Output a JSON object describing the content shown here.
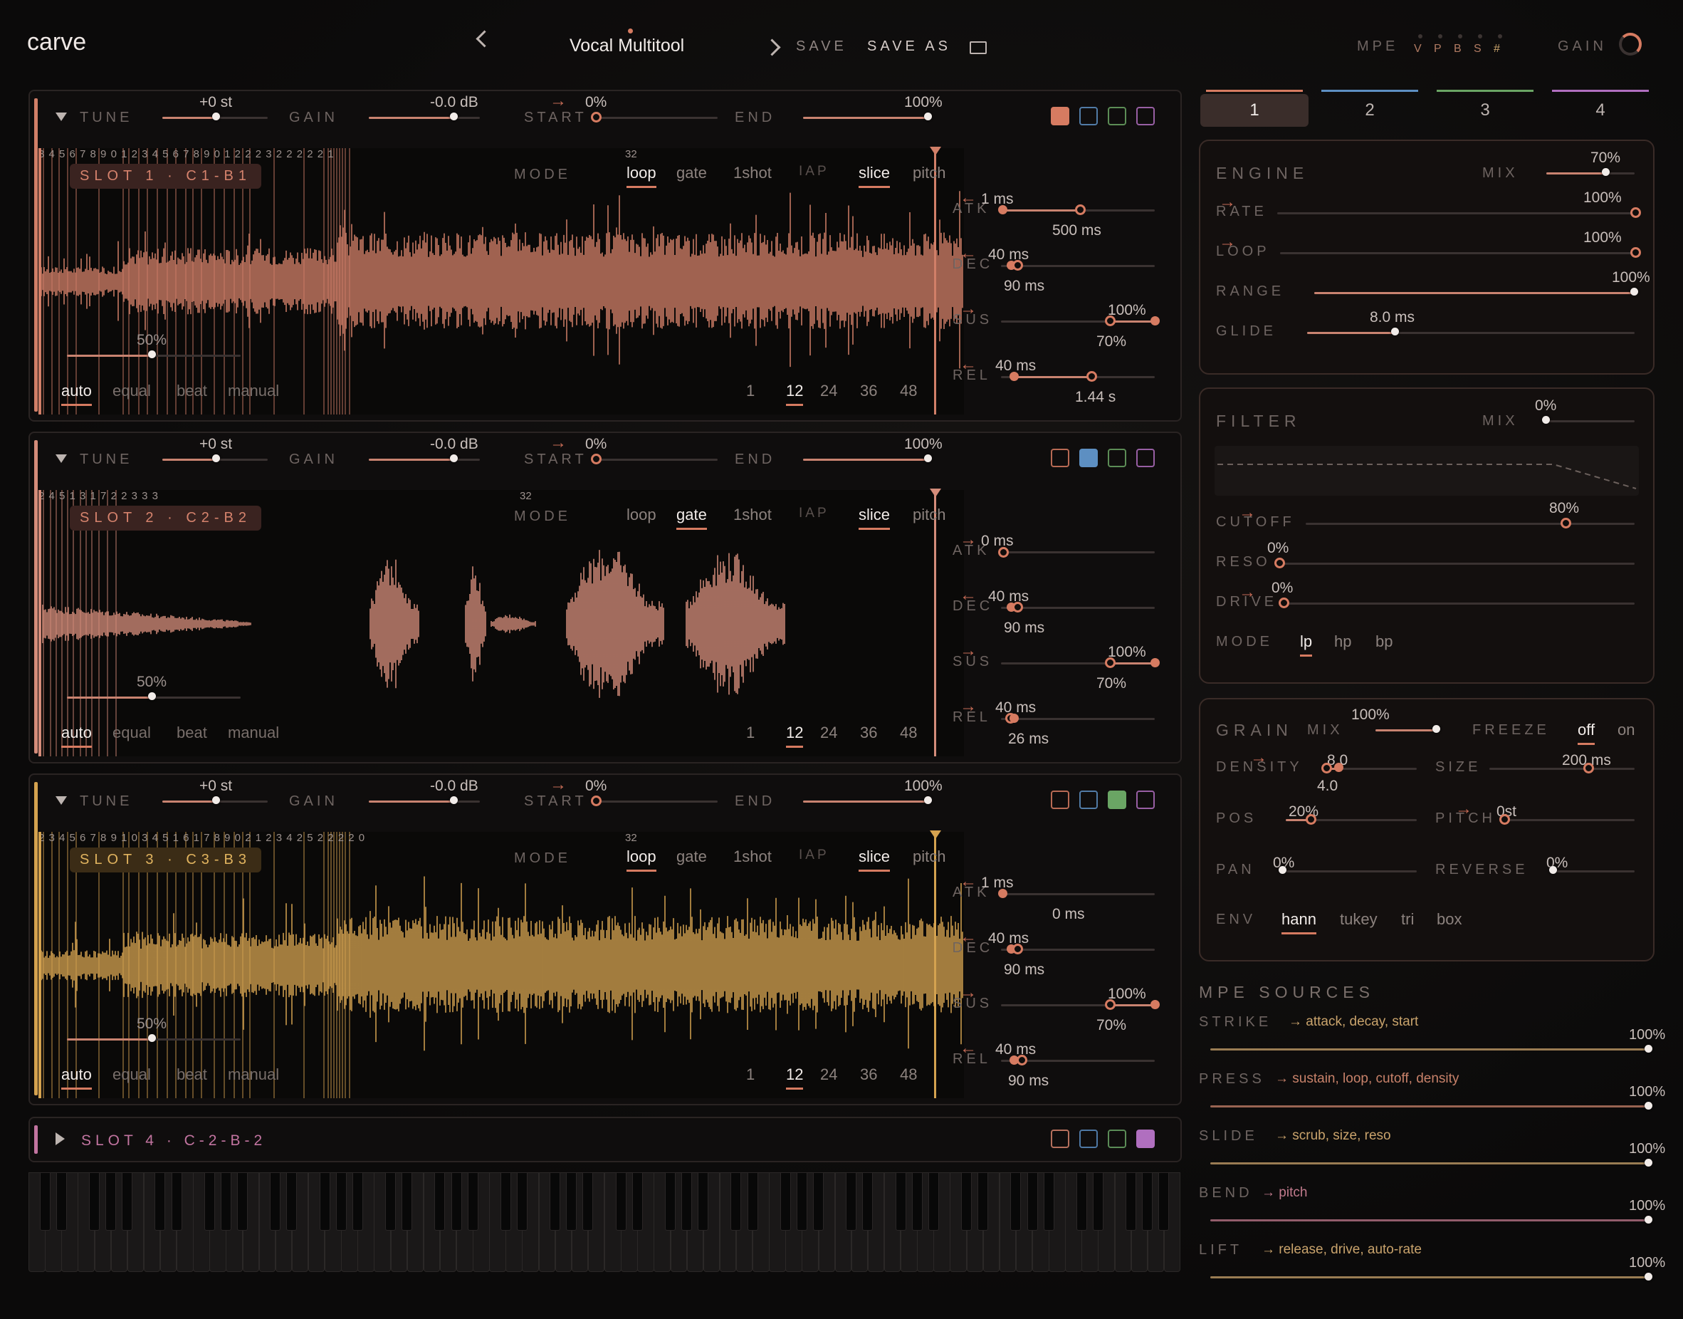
{
  "header": {
    "logo": "carve",
    "preset_name": "Vocal Multitool",
    "save": "SAVE",
    "save_as": "SAVE AS",
    "mpe": "MPE",
    "mpe_flags": [
      "V",
      "P",
      "B",
      "S",
      "#"
    ],
    "gain": "GAIN"
  },
  "labels": {
    "tune": "TUNE",
    "gain": "GAIN",
    "start": "START",
    "end": "END",
    "mode": "MODE",
    "atk": "ATK",
    "dec": "DEC",
    "sus": "SUS",
    "rel": "REL",
    "slice_count": "32"
  },
  "modes": [
    "loop",
    "gate",
    "1shot",
    "IAP",
    "slice",
    "pitch"
  ],
  "slice_methods": [
    "auto",
    "equal",
    "beat",
    "manual"
  ],
  "slice_counts": [
    "1",
    "12",
    "24",
    "36",
    "48"
  ],
  "slots": [
    {
      "name": "SLOT 1 · C1-B1",
      "tune": "+0 st",
      "gain": "-0.0 dB",
      "start": "0%",
      "end": "100%",
      "threshold": "50%",
      "active_mode": "loop",
      "atk": "1 ms",
      "atk2": "500 ms",
      "dec": "40 ms",
      "dec2": "90 ms",
      "sus": "100%",
      "sus2": "70%",
      "rel": "40 ms",
      "rel2": "1.44 s",
      "ruler": "3 4 5 6 7   8   9 0 1 2 3 4 5 6 7 8 9 0 1 2 2   2 3   2 2 2 2 2 1"
    },
    {
      "name": "SLOT 2 · C2-B2",
      "tune": "+0 st",
      "gain": "-0.0 dB",
      "start": "0%",
      "end": "100%",
      "threshold": "50%",
      "active_mode": "gate",
      "atk": "0 ms",
      "atk2": "",
      "dec": "40 ms",
      "dec2": "90 ms",
      "sus": "100%",
      "sus2": "70%",
      "rel": "40 ms",
      "rel2": "26 ms",
      "ruler": "2 4 5 1 3 1 7 2 2 3 3 3"
    },
    {
      "name": "SLOT 3 · C3-B3",
      "tune": "+0 st",
      "gain": "-0.0 dB",
      "start": "0%",
      "end": "100%",
      "threshold": "50%",
      "active_mode": "loop",
      "atk": "1 ms",
      "atk2": "0 ms",
      "dec": "40 ms",
      "dec2": "90 ms",
      "sus": "100%",
      "sus2": "70%",
      "rel": "40 ms",
      "rel2": "90 ms",
      "ruler": "2 3 4 5 6 7 8 9 1 0 3 4 5 1 6 1 7 8 9 0 2 1 2 3 4   2 5   2 2 2 2 0"
    }
  ],
  "slot4": {
    "name": "SLOT 4 · C-2-B-2"
  },
  "tabs": [
    "1",
    "2",
    "3",
    "4"
  ],
  "tab_colors": [
    "#d67b61",
    "#5d8fc2",
    "#6aa564",
    "#b06fbf"
  ],
  "engine": {
    "title": "ENGINE",
    "mix_label": "MIX",
    "mix": "70%",
    "rate_label": "RATE",
    "rate": "100%",
    "loop_label": "LOOP",
    "loop": "100%",
    "range_label": "RANGE",
    "range": "100%",
    "glide_label": "GLIDE",
    "glide": "8.0 ms"
  },
  "filter": {
    "title": "FILTER",
    "mix_label": "MIX",
    "mix": "0%",
    "cutoff_label": "CUTOFF",
    "cutoff": "80%",
    "reso_label": "RESO",
    "reso": "0%",
    "drive_label": "DRIVE",
    "drive": "0%",
    "mode_label": "MODE",
    "modes": [
      "lp",
      "hp",
      "bp"
    ]
  },
  "grain": {
    "title": "GRAIN",
    "mix_label": "MIX",
    "mix": "100%",
    "freeze_label": "FREEZE",
    "freeze_off": "off",
    "freeze_on": "on",
    "density_label": "DENSITY",
    "density": "8.0",
    "density2": "4.0",
    "size_label": "SIZE",
    "size": "200 ms",
    "pos_label": "POS",
    "pos": "20%",
    "pitch_label": "PITCH",
    "pitch": "0st",
    "pan_label": "PAN",
    "pan": "0%",
    "reverse_label": "REVERSE",
    "reverse": "0%",
    "env_label": "ENV",
    "envs": [
      "hann",
      "tukey",
      "tri",
      "box"
    ]
  },
  "mpe_sources": {
    "title": "MPE SOURCES",
    "items": [
      {
        "name": "STRIKE",
        "targets": "→ attack, decay, start",
        "amount": "100%",
        "color": "#c9a36c"
      },
      {
        "name": "PRESS",
        "targets": "→ sustain, loop, cutoff, density",
        "amount": "100%",
        "color": "#c8826a"
      },
      {
        "name": "SLIDE",
        "targets": "→ scrub, size, reso",
        "amount": "100%",
        "color": "#c9a36c"
      },
      {
        "name": "BEND",
        "targets": "→ pitch",
        "amount": "100%",
        "color": "#c07a8c"
      },
      {
        "name": "LIFT",
        "targets": "→ release, drive, auto-rate",
        "amount": "100%",
        "color": "#c9a36c"
      }
    ]
  },
  "colors": {
    "slot1": "#d17f68",
    "slot2": "#d48c7a",
    "slot3": "#d4a24f",
    "slot4": "#c274a0",
    "accent": "#d67b61"
  }
}
